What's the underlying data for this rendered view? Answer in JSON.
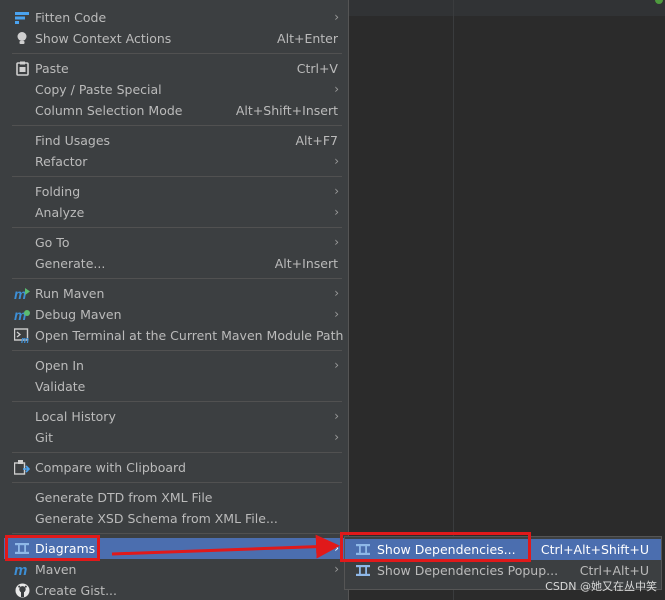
{
  "menu": {
    "items": [
      {
        "label": "Fitten Code",
        "shortcut": "",
        "submenu": true,
        "icon": "fitten-code-icon"
      },
      {
        "label": "Show Context Actions",
        "shortcut": "Alt+Enter",
        "submenu": false,
        "icon": "lightbulb-icon"
      },
      {
        "label": "Paste",
        "shortcut": "Ctrl+V",
        "submenu": false,
        "icon": "clipboard-icon"
      },
      {
        "label": "Copy / Paste Special",
        "shortcut": "",
        "submenu": true,
        "icon": ""
      },
      {
        "label": "Column Selection Mode",
        "shortcut": "Alt+Shift+Insert",
        "submenu": false,
        "icon": ""
      },
      {
        "label": "Find Usages",
        "shortcut": "Alt+F7",
        "submenu": false,
        "icon": ""
      },
      {
        "label": "Refactor",
        "shortcut": "",
        "submenu": true,
        "icon": ""
      },
      {
        "label": "Folding",
        "shortcut": "",
        "submenu": true,
        "icon": ""
      },
      {
        "label": "Analyze",
        "shortcut": "",
        "submenu": true,
        "icon": ""
      },
      {
        "label": "Go To",
        "shortcut": "",
        "submenu": true,
        "icon": ""
      },
      {
        "label": "Generate...",
        "shortcut": "Alt+Insert",
        "submenu": false,
        "icon": ""
      },
      {
        "label": "Run Maven",
        "shortcut": "",
        "submenu": true,
        "icon": "run-maven-icon"
      },
      {
        "label": "Debug Maven",
        "shortcut": "",
        "submenu": true,
        "icon": "debug-maven-icon"
      },
      {
        "label": "Open Terminal at the Current Maven Module Path",
        "shortcut": "",
        "submenu": false,
        "icon": "terminal-maven-icon"
      },
      {
        "label": "Open In",
        "shortcut": "",
        "submenu": true,
        "icon": ""
      },
      {
        "label": "Validate",
        "shortcut": "",
        "submenu": false,
        "icon": ""
      },
      {
        "label": "Local History",
        "shortcut": "",
        "submenu": true,
        "icon": ""
      },
      {
        "label": "Git",
        "shortcut": "",
        "submenu": true,
        "icon": ""
      },
      {
        "label": "Compare with Clipboard",
        "shortcut": "",
        "submenu": false,
        "icon": "compare-icon"
      },
      {
        "label": "Generate DTD from XML File",
        "shortcut": "",
        "submenu": false,
        "icon": ""
      },
      {
        "label": "Generate XSD Schema from XML File...",
        "shortcut": "",
        "submenu": false,
        "icon": ""
      },
      {
        "label": "Diagrams",
        "shortcut": "",
        "submenu": true,
        "icon": "diagram-icon",
        "active": true
      },
      {
        "label": "Maven",
        "shortcut": "",
        "submenu": true,
        "icon": "maven-icon"
      },
      {
        "label": "Create Gist...",
        "shortcut": "",
        "submenu": false,
        "icon": "github-icon"
      }
    ]
  },
  "submenu": {
    "items": [
      {
        "label": "Show Dependencies...",
        "shortcut": "Ctrl+Alt+Shift+U",
        "icon": "diagram-icon",
        "active": true
      },
      {
        "label": "Show Dependencies Popup...",
        "shortcut": "Ctrl+Alt+U",
        "icon": "diagram-icon"
      }
    ]
  },
  "arrow_glyph": "›",
  "watermark": "CSDN @她又在丛中笑",
  "colors": {
    "menu_bg": "#3c3f41",
    "selection": "#4b6eaf",
    "text": "#bbbbbb",
    "annotation": "#e0191a"
  }
}
